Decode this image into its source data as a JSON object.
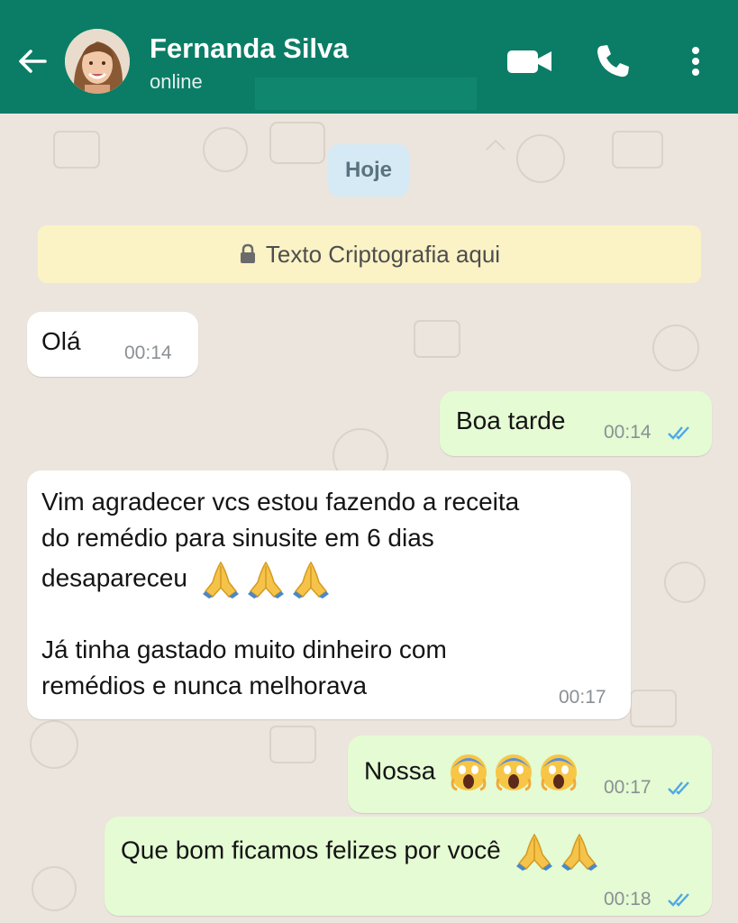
{
  "header": {
    "contact_name": "Fernanda Silva",
    "status": "online",
    "background_color": "#0b7d66"
  },
  "icons": {
    "back": "arrow-left-icon",
    "video": "video-camera-icon",
    "call": "phone-icon",
    "menu": "more-vertical-icon",
    "lock": "lock-icon",
    "read_receipt": "double-check-icon",
    "praying_hands": "🙏",
    "screaming_face": "😱"
  },
  "chat": {
    "date_label": "Hoje",
    "encryption_notice": "Texto Criptografia aqui",
    "messages": [
      {
        "direction": "incoming",
        "text": "Olá",
        "time": "00:14"
      },
      {
        "direction": "outgoing",
        "text": "Boa tarde",
        "time": "00:14",
        "read": true
      },
      {
        "direction": "incoming",
        "lines": [
          "Vim agradecer vcs estou fazendo a receita",
          "do remédio para sinusite em 6 dias",
          "desapareceu",
          "",
          "Já tinha gastado muito dinheiro com",
          "remédios e nunca melhorava"
        ],
        "emoji_after_line_3": "🙏🙏🙏",
        "time": "00:17"
      },
      {
        "direction": "outgoing",
        "text": "Nossa",
        "emoji": "😱😱😱",
        "time": "00:17",
        "read": true
      },
      {
        "direction": "outgoing",
        "text": "Que bom ficamos felizes por você",
        "emoji": "🙏🙏",
        "time": "00:18",
        "read": true
      }
    ]
  },
  "colors": {
    "incoming_bubble": "#ffffff",
    "outgoing_bubble": "#e4fbd3",
    "read_tick": "#4fa8e6",
    "date_chip": "#d5eaf4",
    "encryption_banner": "#fbf3c5"
  }
}
